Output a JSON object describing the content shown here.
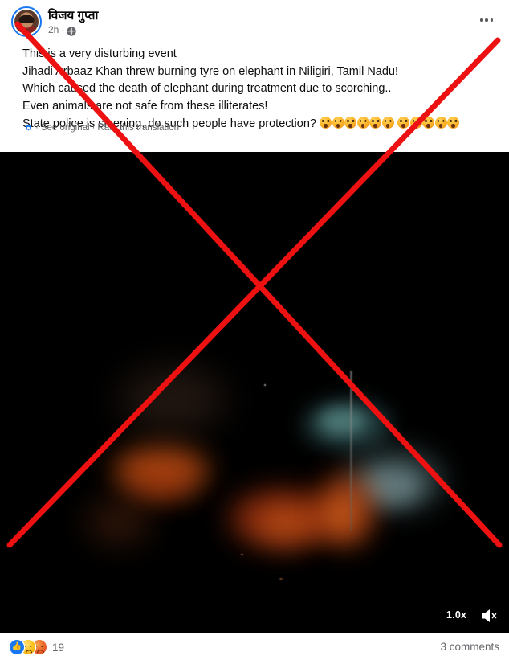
{
  "post": {
    "author": "विजय गुप्ता",
    "timestamp": "2h",
    "meta_separator": "·",
    "audience_icon": "globe-icon",
    "menu_icon": "ellipsis-icon",
    "avatar_alt": "profile-photo",
    "body_lines": [
      "This is a very disturbing event",
      "Jihadi Arbaaz Khan threw burning tyre on elephant in Niligiri, Tamil Nadu!",
      "Which caused the death of elephant during treatment due to scorching..",
      "Even animals are not safe from these illiterates!"
    ],
    "last_line_text": "State police is sleeping, do such people have protection? ",
    "emoji_name": "shocked-face-emoji",
    "emoji_group_1_count": 6,
    "emoji_group_2_count": 5,
    "translation": {
      "gear_icon": "gear-icon",
      "separator_1": "·",
      "see_original": "See original",
      "separator_2": "·",
      "rate_translation": "Rate this translation"
    }
  },
  "video": {
    "speed_label": "1.0x",
    "mute_icon": "speaker-muted-icon",
    "background_color": "#000000"
  },
  "footer": {
    "reaction_icons": [
      "like-icon",
      "sad-icon",
      "angry-icon"
    ],
    "reaction_count": "19",
    "comments": "3 comments"
  },
  "overlay": {
    "mark_name": "red-x-debunk-mark",
    "color": "#ee1111",
    "stroke_width": 7
  }
}
